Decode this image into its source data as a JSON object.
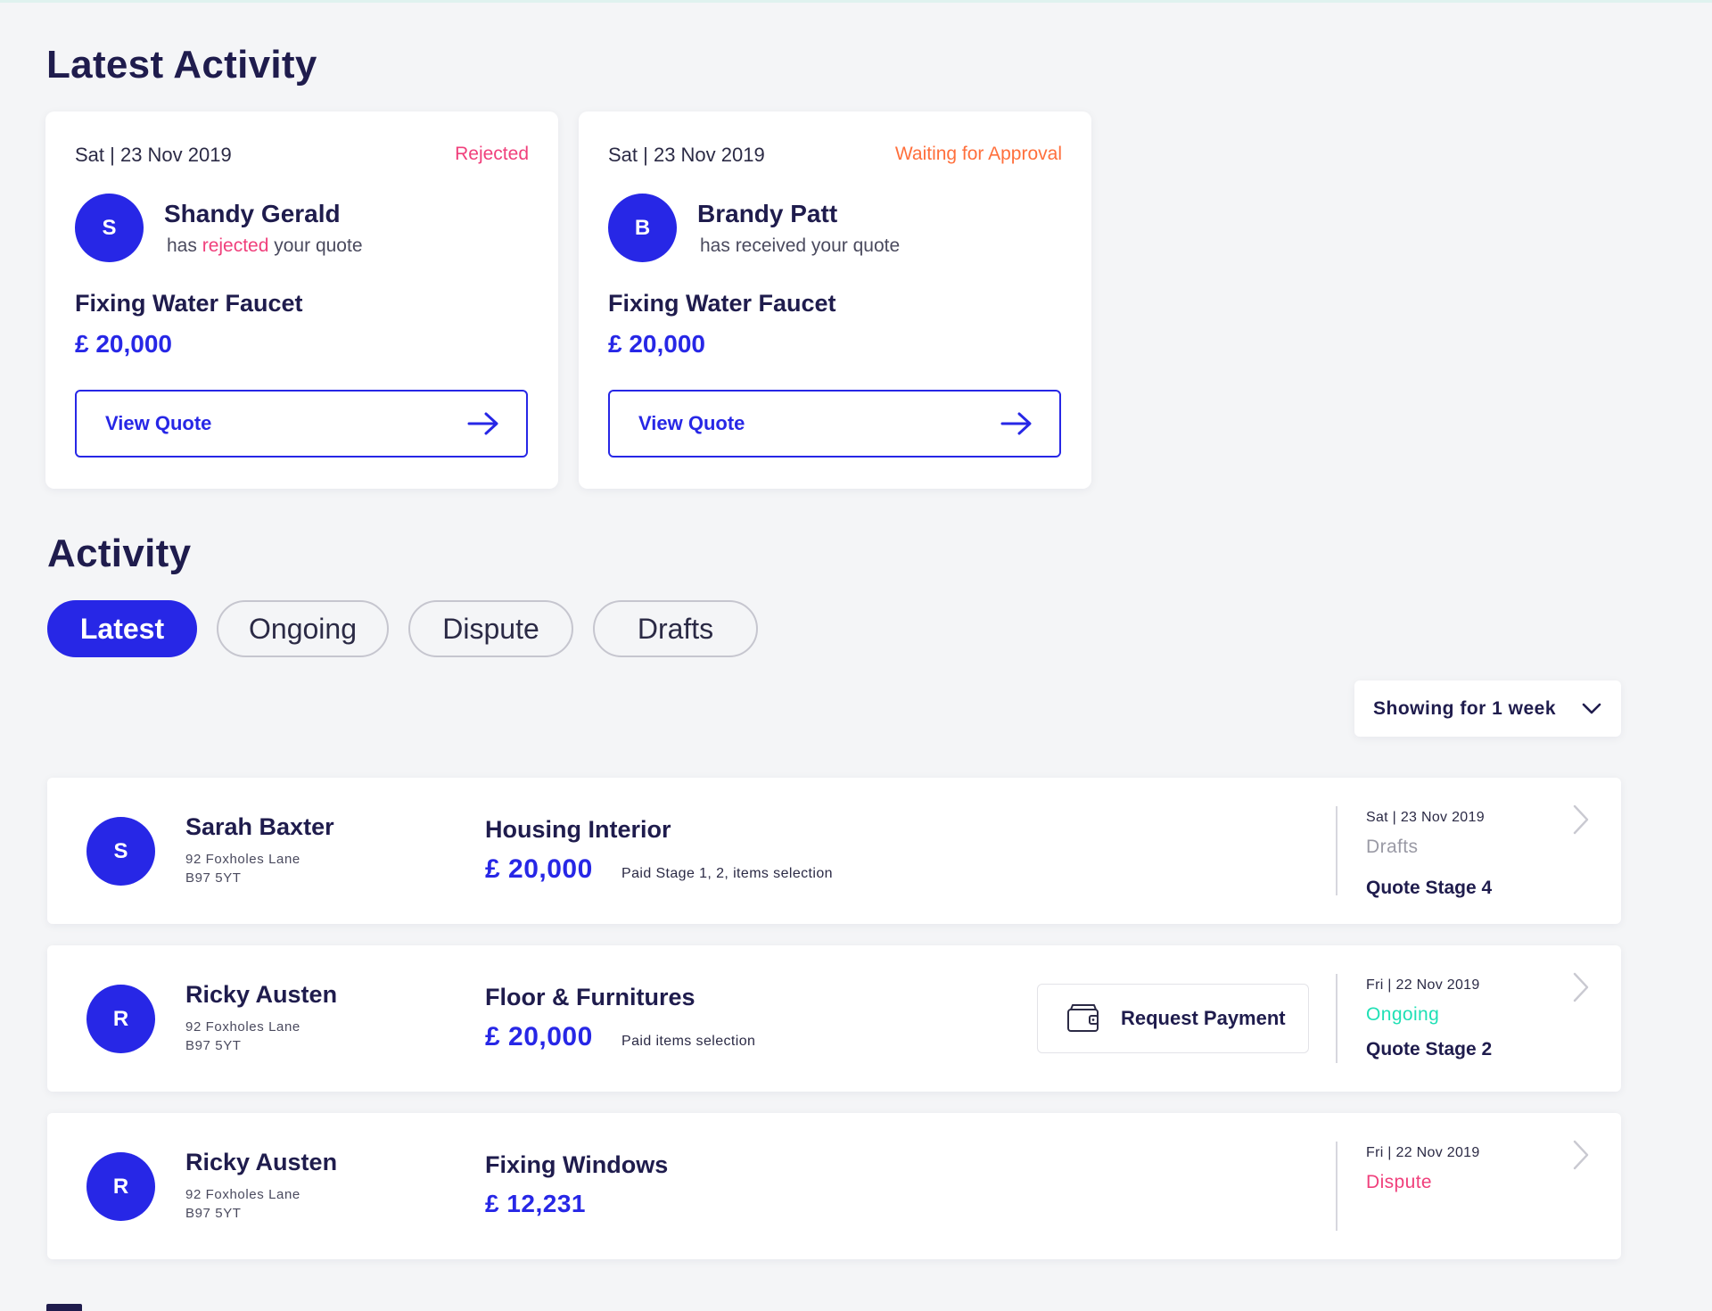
{
  "latest_activity": {
    "title": "Latest Activity",
    "cards": [
      {
        "date": "Sat | 23 Nov 2019",
        "status": "Rejected",
        "status_color": "#f0407c",
        "avatar_initial": "S",
        "name": "Shandy Gerald",
        "sub_prefix": "has ",
        "sub_highlight": "rejected",
        "sub_suffix": " your quote",
        "job": "Fixing Water Faucet",
        "price": "£ 20,000",
        "button_label": "View Quote"
      },
      {
        "date": "Sat | 23 Nov 2019",
        "status": "Waiting for Approval",
        "status_color": "#ff6f3c",
        "avatar_initial": "B",
        "name": "Brandy Patt",
        "sub_prefix": "has received your quote",
        "job": "Fixing Water Faucet",
        "price": "£ 20,000",
        "button_label": "View Quote"
      }
    ]
  },
  "activity": {
    "title": "Activity",
    "tabs": [
      {
        "label": "Latest",
        "active": true
      },
      {
        "label": "Ongoing",
        "active": false
      },
      {
        "label": "Dispute",
        "active": false
      },
      {
        "label": "Drafts",
        "active": false
      }
    ],
    "filter": {
      "label": "Showing for 1 week",
      "icon": "chevron-down-icon"
    },
    "rows": [
      {
        "avatar_initial": "S",
        "name": "Sarah Baxter",
        "address_line1": "92 Foxholes Lane",
        "address_line2": "B97 5YT",
        "job": "Housing Interior",
        "price": "£ 20,000",
        "note": "Paid Stage 1, 2, items selection",
        "date": "Sat | 23 Nov 2019",
        "status": "Drafts",
        "status_color": "#9a9aa5",
        "stage": "Quote Stage 4"
      },
      {
        "avatar_initial": "R",
        "name": "Ricky Austen",
        "address_line1": "92 Foxholes Lane",
        "address_line2": "B97 5YT",
        "job": "Floor & Furnitures",
        "price": "£ 20,000",
        "note": "Paid items selection",
        "action_label": "Request Payment",
        "date": "Fri | 22 Nov 2019",
        "status": "Ongoing",
        "status_color": "#1fe0b5",
        "stage": "Quote Stage 2"
      },
      {
        "avatar_initial": "R",
        "name": "Ricky Austen",
        "address_line1": "92 Foxholes Lane",
        "address_line2": "B97 5YT",
        "job": "Fixing Windows",
        "price": "£ 12,231",
        "date": "Fri | 22 Nov 2019",
        "status": "Dispute",
        "status_color": "#f0407c"
      }
    ]
  },
  "colors": {
    "accent": "#2727e6",
    "heading": "#1f1c4d",
    "background": "#f4f5f7"
  }
}
